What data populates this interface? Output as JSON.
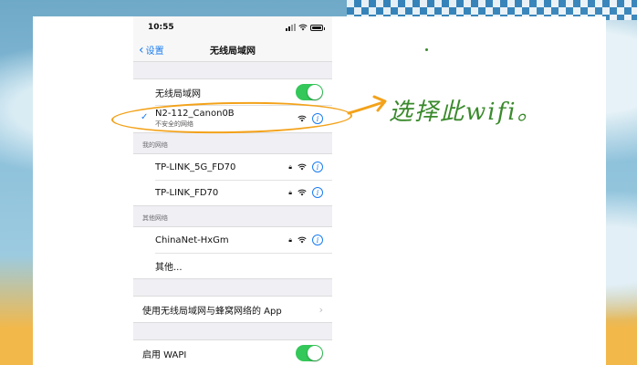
{
  "status_bar": {
    "time": "10:55"
  },
  "nav": {
    "back_label": "设置",
    "title": "无线局域网"
  },
  "wifi_toggle": {
    "label": "无线局域网",
    "on": true
  },
  "connected_network": {
    "name": "N2-112_Canon0B",
    "subtitle": "不安全的网络"
  },
  "my_networks": {
    "header": "我的网络",
    "items": [
      {
        "name": "TP-LINK_5G_FD70"
      },
      {
        "name": "TP-LINK_FD70"
      }
    ]
  },
  "other_networks": {
    "header": "其他网络",
    "items": [
      {
        "name": "ChinaNet-HxGm"
      }
    ],
    "other_label": "其他..."
  },
  "apps_row": {
    "label": "使用无线局域网与蜂窝网络的 App"
  },
  "wapi_row": {
    "label": "启用 WAPI",
    "on": true
  },
  "annotation": {
    "text": "选择此wifi。",
    "color": "#3a8a2c",
    "circle_color": "#f3a21a"
  },
  "colors": {
    "accent": "#1a7cf2",
    "toggle_on": "#34c759"
  }
}
